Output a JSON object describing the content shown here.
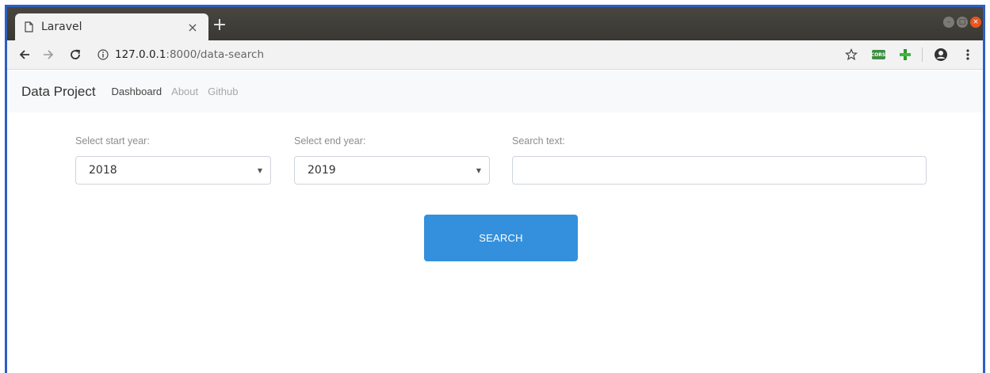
{
  "browser": {
    "tab_title": "Laravel",
    "tab_close": "×",
    "new_tab": "+",
    "url_host": "127.0.0.1",
    "url_rest": ":8000/data-search",
    "cors_label": "CORS",
    "accent": "#2a5fc4"
  },
  "navbar": {
    "brand": "Data Project",
    "links": [
      "Dashboard",
      "About",
      "Github"
    ]
  },
  "form": {
    "start_label": "Select start year:",
    "start_value": "2018",
    "end_label": "Select end year:",
    "end_value": "2019",
    "search_label": "Search text:",
    "search_value": "",
    "caret": "▼",
    "submit_label": "SEARCH",
    "submit_color": "#3490dc"
  }
}
